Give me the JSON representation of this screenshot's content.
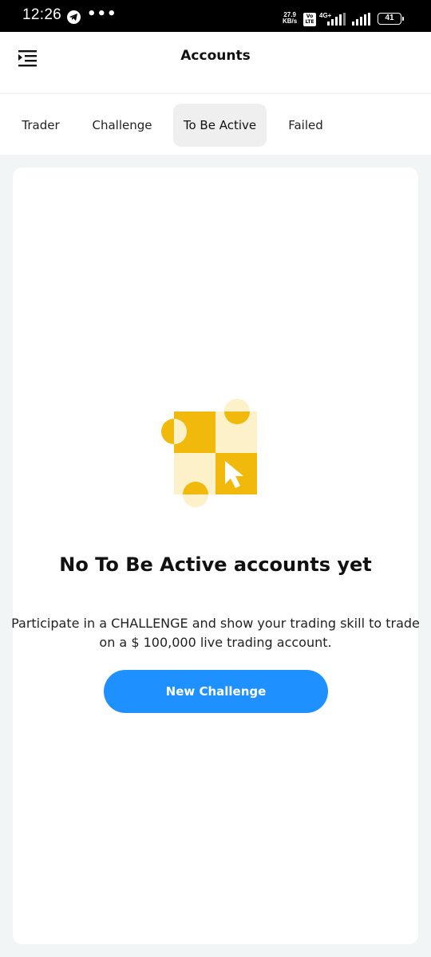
{
  "status_bar": {
    "time": "12:26",
    "speed_top": "27.9",
    "speed_unit": "KB/s",
    "volte": "Vo LTE",
    "net_type": "4G+",
    "battery": "41"
  },
  "header": {
    "title": "Accounts",
    "menu_icon": "menu-indent-icon"
  },
  "tabs": [
    {
      "label": "Trader",
      "active": false
    },
    {
      "label": "Challenge",
      "active": false
    },
    {
      "label": "To Be Active",
      "active": true
    },
    {
      "label": "Failed",
      "active": false
    }
  ],
  "empty_state": {
    "illustration": "checkerboard-cursor-illustration",
    "title": "No To Be Active accounts yet",
    "description_line1": "Participate in a CHALLENGE and show your trading skill to trade",
    "description_line2": "on a $ 100,000 live trading account.",
    "button_label": "New Challenge"
  },
  "colors": {
    "accent": "#1e90ff",
    "illustration_yellow": "#f0b90b",
    "illustration_light": "#fdf1c9",
    "background": "#f2f5f6"
  }
}
